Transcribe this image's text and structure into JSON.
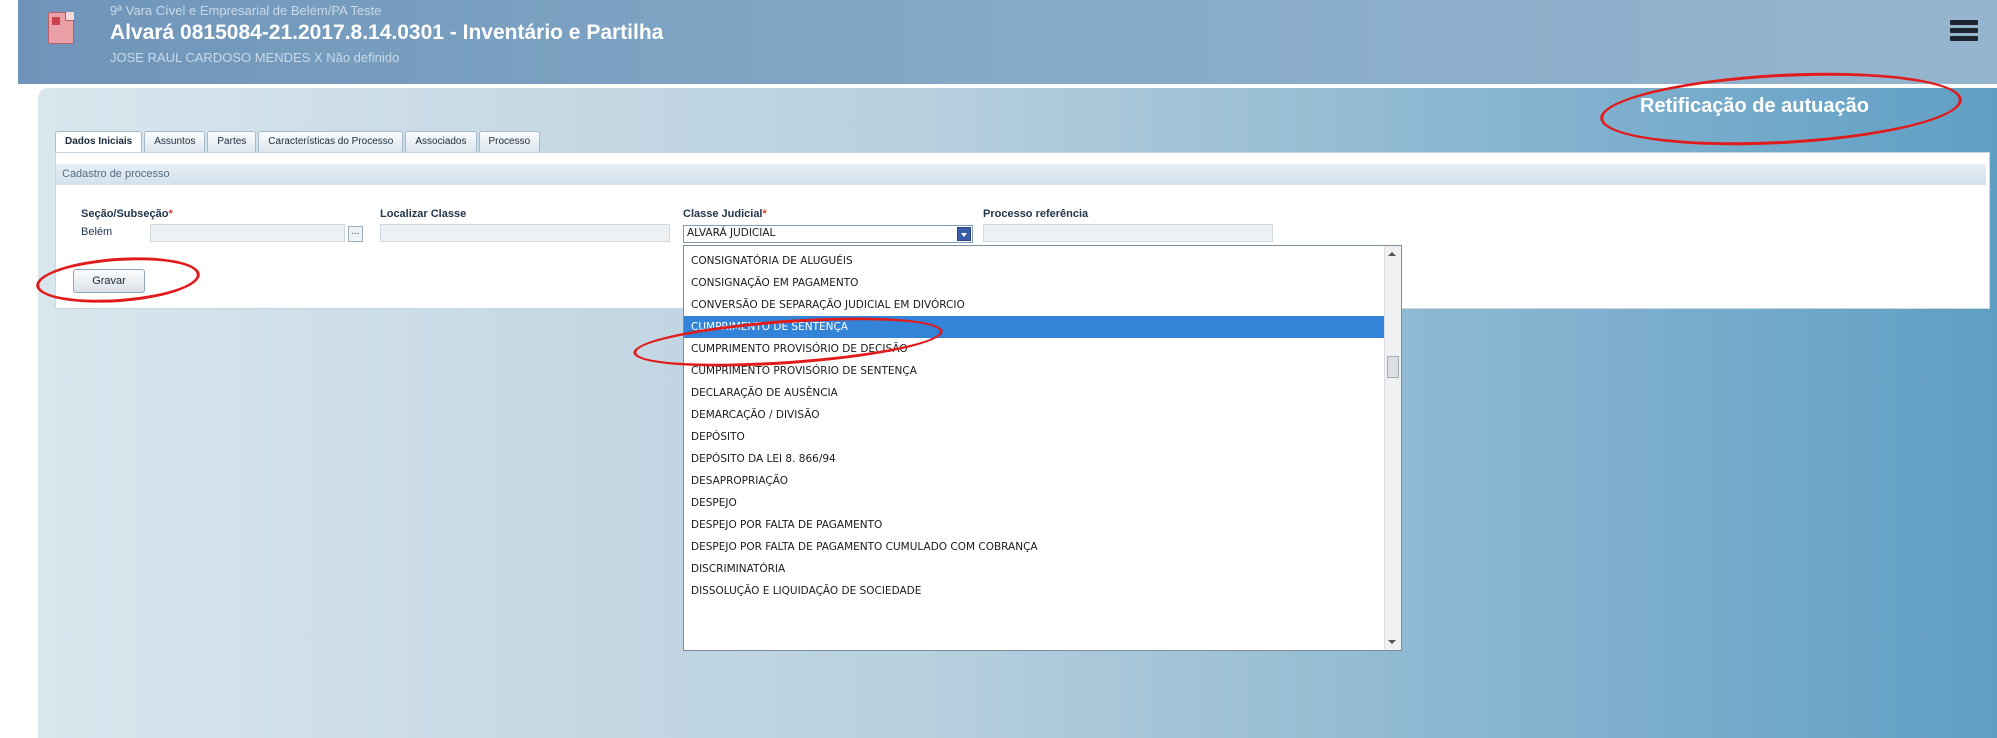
{
  "header": {
    "court": "9ª Vara Cível e Empresarial de Belém/PA Teste",
    "title": "Alvará 0815084-21.2017.8.14.0301 - Inventário e Partilha",
    "parties": "JOSE RAUL CARDOSO MENDES X Não definido"
  },
  "page": {
    "heading": "Retificação de autuação"
  },
  "tabs": [
    {
      "label": "Dados Iniciais"
    },
    {
      "label": "Assuntos"
    },
    {
      "label": "Partes"
    },
    {
      "label": "Características do Processo"
    },
    {
      "label": "Associados"
    },
    {
      "label": "Processo"
    }
  ],
  "form": {
    "section_title": "Cadastro de processo",
    "secao": {
      "label": "Seção/Subseção",
      "value": "Belém",
      "lookup_button": "..."
    },
    "localizar_classe": {
      "label": "Localizar Classe",
      "value": ""
    },
    "classe_judicial": {
      "label": "Classe Judicial",
      "value": "ALVARÁ JUDICIAL"
    },
    "processo_referencia": {
      "label": "Processo referência",
      "value": ""
    },
    "required_marker": "*",
    "save_label": "Gravar"
  },
  "dropdown": {
    "options": [
      "CONSIGNATÓRIA DE ALUGUÉIS",
      "CONSIGNAÇÃO EM PAGAMENTO",
      "CONVERSÃO DE SEPARAÇÃO JUDICIAL EM DIVÓRCIO",
      "CUMPRIMENTO DE SENTENÇA",
      "CUMPRIMENTO PROVISÓRIO DE DECISÃO",
      "CUMPRIMENTO PROVISÓRIO DE SENTENÇA",
      "DECLARAÇÃO DE AUSÊNCIA",
      "DEMARCAÇÃO / DIVISÃO",
      "DEPÓSITO",
      "DEPÓSITO DA LEI 8. 866/94",
      "DESAPROPRIAÇÃO",
      "DESPEJO",
      "DESPEJO POR FALTA DE PAGAMENTO",
      "DESPEJO POR FALTA DE PAGAMENTO CUMULADO COM COBRANÇA",
      "DISCRIMINATÓRIA",
      "DISSOLUÇÃO E LIQUIDAÇÃO DE SOCIEDADE"
    ],
    "selected": "CUMPRIMENTO DE SENTENÇA"
  },
  "colors": {
    "header": "#7fa3c3",
    "selection": "#3384d8",
    "annotation": "#e11b1b"
  },
  "icons": [
    "document-icon",
    "menu-icon",
    "dropdown-arrow-icon"
  ]
}
